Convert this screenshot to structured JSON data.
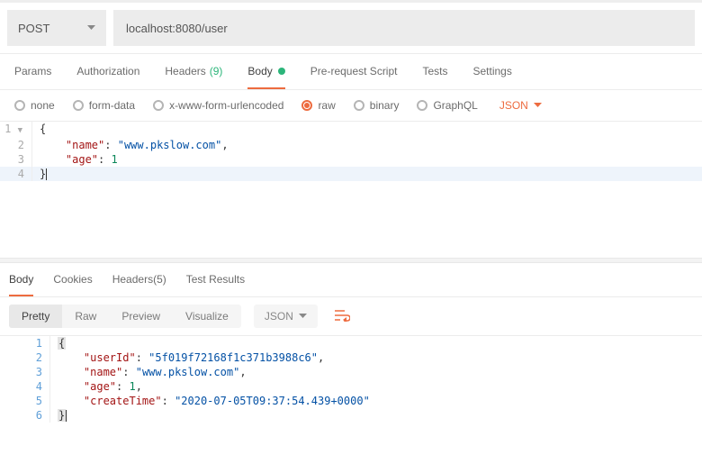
{
  "request": {
    "method": "POST",
    "url": "localhost:8080/user"
  },
  "tabs": {
    "params": "Params",
    "authorization": "Authorization",
    "headers": "Headers",
    "headers_count": "(9)",
    "body": "Body",
    "prerequest": "Pre-request Script",
    "tests": "Tests",
    "settings": "Settings"
  },
  "body_types": {
    "none": "none",
    "formdata": "form-data",
    "urlencoded": "x-www-form-urlencoded",
    "raw": "raw",
    "binary": "binary",
    "graphql": "GraphQL",
    "format": "JSON"
  },
  "req_body": {
    "l1_num": "1",
    "l2_num": "2",
    "l3_num": "3",
    "l4_num": "4",
    "l1": "{",
    "l2_key": "\"name\"",
    "l2_val": "\"www.pkslow.com\"",
    "l3_key": "\"age\"",
    "l3_val": "1",
    "l4": "}"
  },
  "resp_tabs": {
    "body": "Body",
    "cookies": "Cookies",
    "headers": "Headers",
    "headers_count": "(5)",
    "tests": "Test Results"
  },
  "view": {
    "pretty": "Pretty",
    "raw": "Raw",
    "preview": "Preview",
    "visualize": "Visualize",
    "format": "JSON"
  },
  "resp_body": {
    "l1_num": "1",
    "l2_num": "2",
    "l3_num": "3",
    "l4_num": "4",
    "l5_num": "5",
    "l6_num": "6",
    "l1": "{",
    "l2_key": "\"userId\"",
    "l2_val": "\"5f019f72168f1c371b3988c6\"",
    "l3_key": "\"name\"",
    "l3_val": "\"www.pkslow.com\"",
    "l4_key": "\"age\"",
    "l4_val": "1",
    "l5_key": "\"createTime\"",
    "l5_val": "\"2020-07-05T09:37:54.439+0000\"",
    "l6": "}"
  }
}
